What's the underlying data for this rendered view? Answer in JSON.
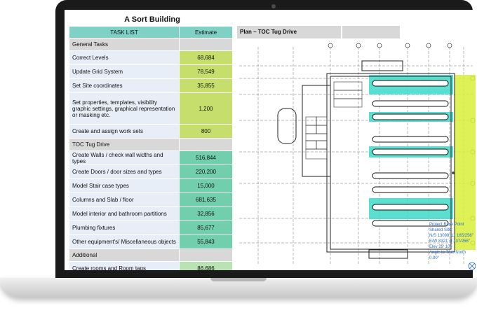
{
  "sheet": {
    "title": "A Sort Building",
    "header": {
      "task_col": "TASK LIST",
      "estimate_col": "Estimate"
    },
    "rows": [
      {
        "type": "section",
        "label": "General Tasks"
      },
      {
        "type": "task",
        "label": "Correct Levels",
        "estimate": "68,684",
        "color": "yellow"
      },
      {
        "type": "task",
        "label": "Update Grid System",
        "estimate": "78,549",
        "color": "yellow"
      },
      {
        "type": "task",
        "label": "Set Site coordinates",
        "estimate": "35,855",
        "color": "yellow"
      },
      {
        "type": "task",
        "label": "Set properties, templates, visibility graphic settings, graphical representation or masking etc.",
        "estimate": "1,200",
        "color": "yellow"
      },
      {
        "type": "task",
        "label": "Create and assign work sets",
        "estimate": "800",
        "color": "yellow"
      },
      {
        "type": "section",
        "label": "TOC Tug Drive"
      },
      {
        "type": "task",
        "label": "Create Walls / check wall widths and types",
        "estimate": "516,844",
        "color": "teal"
      },
      {
        "type": "task",
        "label": "Create Doors / door sizes and types",
        "estimate": "220,200",
        "color": "teal"
      },
      {
        "type": "task",
        "label": "Model Stair case types",
        "estimate": "15,000",
        "color": "teal"
      },
      {
        "type": "task",
        "label": "Columns and Slab / floor",
        "estimate": "681,635",
        "color": "teal"
      },
      {
        "type": "task",
        "label": "Model interior and bathroom partitions",
        "estimate": "32,856",
        "color": "teal"
      },
      {
        "type": "task",
        "label": "Plumbing fixtures",
        "estimate": "85,677",
        "color": "teal"
      },
      {
        "type": "task",
        "label": "Other equipment's/ Miscellaneous objects",
        "estimate": "55,843",
        "color": "teal"
      },
      {
        "type": "section",
        "label": "Additional"
      },
      {
        "type": "task",
        "label": "Create rooms and Room tags",
        "estimate": "86,686",
        "color": "light"
      }
    ]
  },
  "plan": {
    "title": "Plan – TOC Tug Drive",
    "base_point": {
      "title": "Project Base Point",
      "shared_site": "Shared Site:",
      "ns": "N/S   13098' 11 165/256\"",
      "ew": "E/W   8321' 0 137/256\"",
      "elev": "Elev   29' 10\"",
      "angle": "Angle to True North   0.00°"
    }
  },
  "colors": {
    "bezel": "#1a1a1a",
    "header_teal": "#7fd1c5",
    "estimate_yellow": "#c6df6c",
    "estimate_teal": "#71cfae",
    "estimate_light": "#b9e3b2",
    "plan_cyan": "#3dd9c8",
    "plan_yellow": "#d8ee3a"
  }
}
